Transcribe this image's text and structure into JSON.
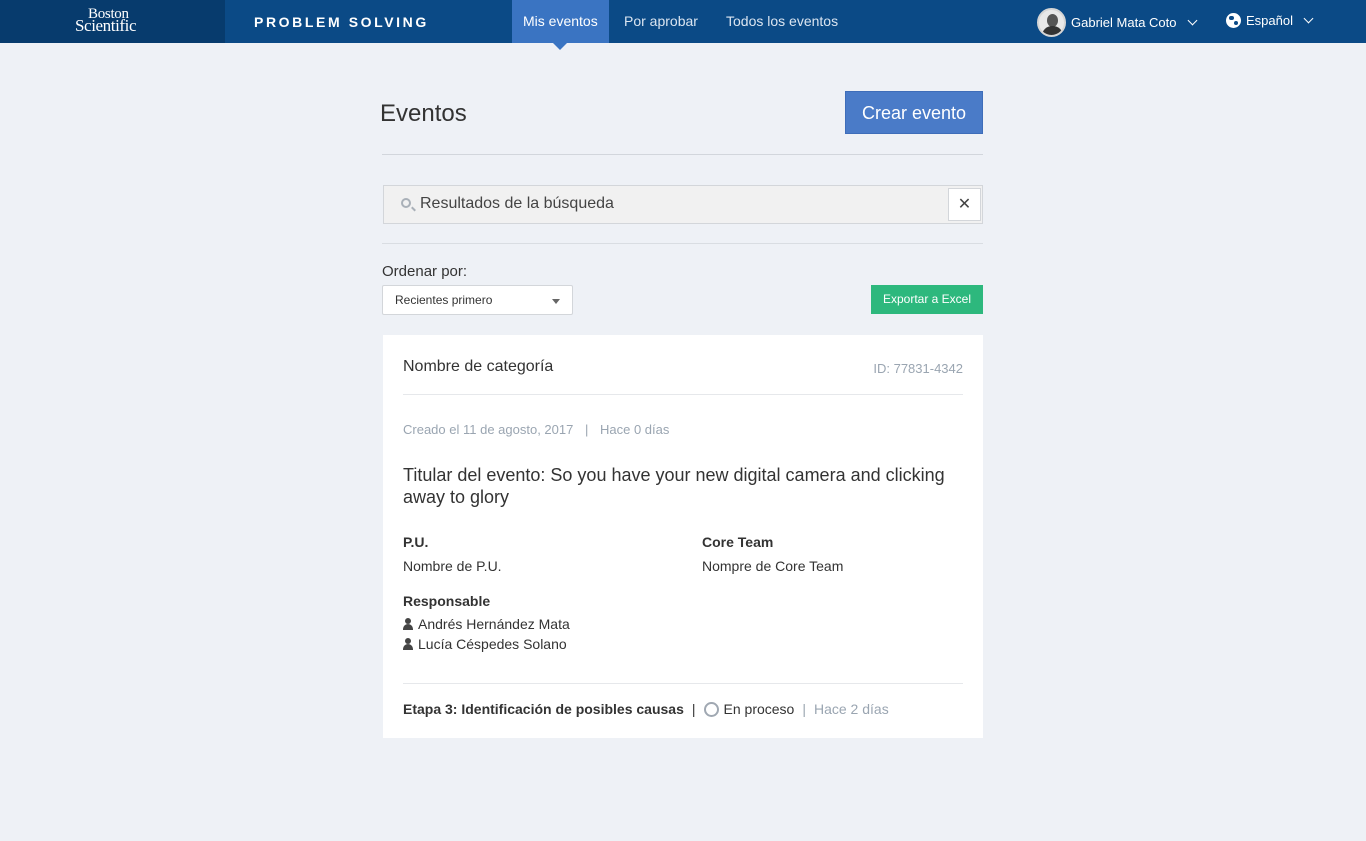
{
  "brand": {
    "line1": "Boston",
    "line2": "Scientific"
  },
  "app_title": "PROBLEM SOLVING",
  "nav": {
    "tabs": [
      {
        "label": "Mis eventos",
        "active": true
      },
      {
        "label": "Por aprobar",
        "active": false
      },
      {
        "label": "Todos los eventos",
        "active": false
      }
    ]
  },
  "user": {
    "name": "Gabriel Mata Coto"
  },
  "language": {
    "label": "Español"
  },
  "main": {
    "title": "Eventos",
    "create_button": "Crear evento",
    "search": {
      "value": "Resultados de la búsqueda",
      "clear_label": "✕"
    },
    "sort": {
      "label": "Ordenar por:",
      "selected": "Recientes primero"
    },
    "export_button": "Exportar a Excel"
  },
  "event": {
    "category": "Nombre de categoría",
    "id": "ID: 77831-4342",
    "created_date": "Creado el 11 de agosto, 2017",
    "created_sep": "|",
    "created_ago": "Hace 0 días",
    "headline": "Titular del evento: So you have your new digital camera and clicking away to glory",
    "pu_label": "P.U.",
    "pu_value": "Nombre de P.U.",
    "core_team_label": "Core Team",
    "core_team_value": "Nompre de Core Team",
    "responsible_label": "Responsable",
    "responsibles": [
      "Andrés Hernández Mata",
      "Lucía Céspedes Solano"
    ],
    "stage": "Etapa 3: Identificación de posibles causas",
    "stage_sep": "|",
    "status": "En proceso",
    "status_sep": "|",
    "status_ago": "Hace 2 días"
  },
  "colors": {
    "nav_bg": "#0b4a86",
    "nav_active": "#3a74c2",
    "primary_button": "#4a7bc8",
    "export_button": "#2db87d",
    "page_bg": "#eef1f6"
  }
}
